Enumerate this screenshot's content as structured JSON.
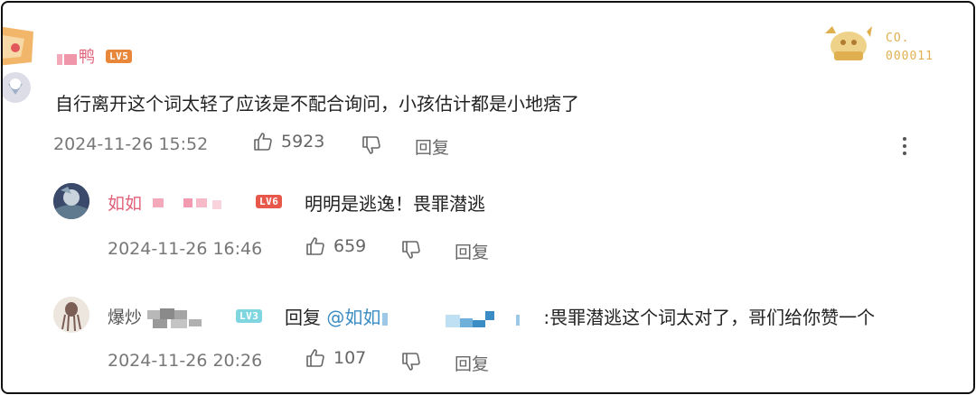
{
  "main_comment": {
    "username": "鸭",
    "level": "LV5",
    "level_color": "#e8873a",
    "text": "自行离开这个词太轻了应该是不配合询问，小孩估计都是小地痞了",
    "timestamp": "2024-11-26 15:52",
    "likes": "5923",
    "reply_label": "回复",
    "more_icon": "more-vertical-icon",
    "badge": {
      "line1": "CO.",
      "line2": "000011"
    }
  },
  "replies": [
    {
      "username": "如如",
      "level": "LV6",
      "level_color": "#e8584a",
      "text": "明明是逃逸！畏罪潜逃",
      "timestamp": "2024-11-26 16:46",
      "likes": "659",
      "reply_label": "回复"
    },
    {
      "username": "爆炒",
      "level": "LV3",
      "level_color": "#7fd6e0",
      "reply_prefix": "回复",
      "mention": "@如如",
      "text": ":畏罪潜逃这个词太对了，哥们给你赞一个",
      "timestamp": "2024-11-26 20:26",
      "likes": "107",
      "reply_label": "回复"
    }
  ],
  "colors": {
    "username": "#e0607a",
    "mention": "#3a8cc4",
    "meta": "#777777",
    "badge": "#e0b050"
  }
}
